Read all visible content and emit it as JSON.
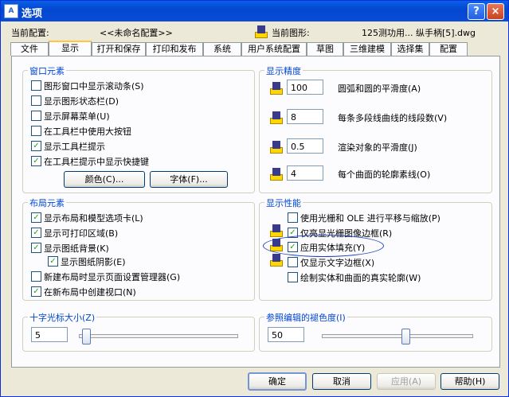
{
  "window": {
    "title": "选项",
    "minimize": "?",
    "close": "×"
  },
  "current": {
    "profile_label": "当前配置:",
    "profile_value": "<<未命名配置>>",
    "drawing_label": "当前图形:",
    "drawing_value": "125测功用... 纵手柄[5].dwg"
  },
  "tabs": [
    "文件",
    "显示",
    "打开和保存",
    "打印和发布",
    "系统",
    "用户系统配置",
    "草图",
    "三维建模",
    "选择集",
    "配置"
  ],
  "window_elements": {
    "title": "窗口元素",
    "checks": [
      {
        "label": "图形窗口中显示滚动条(S)",
        "checked": false
      },
      {
        "label": "显示图形状态栏(D)",
        "checked": false
      },
      {
        "label": "显示屏幕菜单(U)",
        "checked": false
      },
      {
        "label": "在工具栏中使用大按钮",
        "checked": false
      },
      {
        "label": "显示工具栏提示",
        "checked": true
      },
      {
        "label": "在工具栏提示中显示快捷键",
        "checked": true
      }
    ],
    "colors_button": "颜色(C)...",
    "fonts_button": "字体(F)..."
  },
  "layout_elements": {
    "title": "布局元素",
    "checks": [
      {
        "label": "显示布局和模型选项卡(L)",
        "checked": true
      },
      {
        "label": "显示可打印区域(B)",
        "checked": true
      },
      {
        "label": "显示图纸背景(K)",
        "checked": true
      },
      {
        "label": "显示图纸阴影(E)",
        "checked": true
      },
      {
        "label": "新建布局时显示页面设置管理器(G)",
        "checked": false
      },
      {
        "label": "在新布局中创建视口(N)",
        "checked": true
      }
    ]
  },
  "crosshair": {
    "title": "十字光标大小(Z)",
    "value": "5",
    "level": 5
  },
  "resolution": {
    "title": "显示精度",
    "rows": [
      {
        "value": "100",
        "label": "圆弧和圆的平滑度(A)"
      },
      {
        "value": "8",
        "label": "每条多段线曲线的线段数(V)"
      },
      {
        "value": "0.5",
        "label": "渲染对象的平滑度(J)"
      },
      {
        "value": "4",
        "label": "每个曲面的轮廓素线(O)"
      }
    ]
  },
  "performance": {
    "title": "显示性能",
    "checks": [
      {
        "label": "使用光栅和 OLE 进行平移与缩放(P)",
        "checked": false
      },
      {
        "label": "仅亮显光栅图像边框(R)",
        "checked": true
      },
      {
        "label": "应用实体填充(Y)",
        "checked": true
      },
      {
        "label": "仅显示文字边框(X)",
        "checked": false
      },
      {
        "label": "绘制实体和曲面的真实轮廓(W)",
        "checked": false
      }
    ]
  },
  "xref_fade": {
    "title": "参照编辑的褪色度(I)",
    "value": "50",
    "level": 50
  },
  "buttons": {
    "ok": "确定",
    "cancel": "取消",
    "apply": "应用(A)",
    "help": "帮助(H)"
  },
  "colors": {
    "titlebar": "#0a5fe8",
    "group_title": "#0046d5",
    "check_mark": "#21a121",
    "highlight_ellipse": "#1e3fbf"
  }
}
